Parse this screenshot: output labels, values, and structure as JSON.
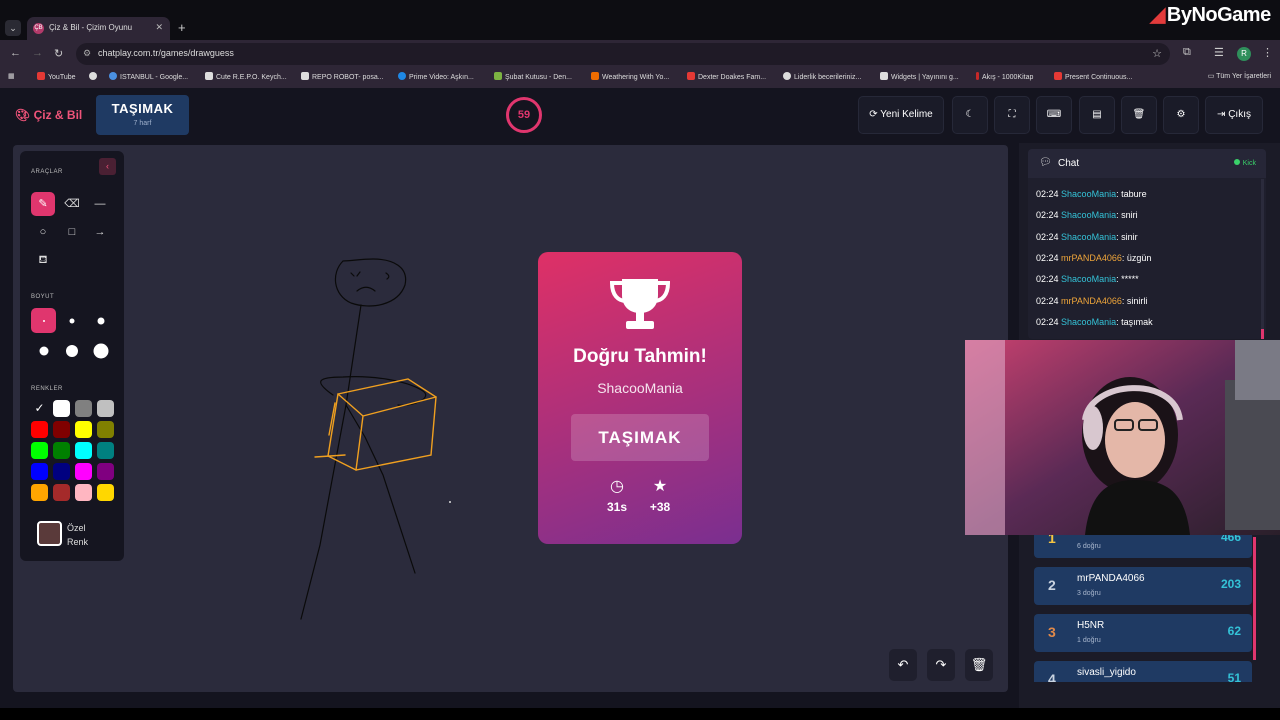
{
  "browser": {
    "tab_title": "Çiz & Bil - Çizim Oyunu",
    "tab_favicon": "ÇB",
    "url": "chatplay.com.tr/games/drawguess",
    "profile_initial": "R",
    "watermark": "ByNoGame",
    "bookmarks": [
      {
        "label": "YouTube",
        "color": "#e53935"
      },
      {
        "label": "",
        "color": "#dddddd"
      },
      {
        "label": "ISTANBUL - Google...",
        "color": "#4a90e2"
      },
      {
        "label": "Cute R.E.P.O. Keych...",
        "color": "#dddddd"
      },
      {
        "label": "REPO ROBOT- posa...",
        "color": "#dddddd"
      },
      {
        "label": "Prime Video: Aşkın...",
        "color": "#1e88e5"
      },
      {
        "label": "Şubat Kutusu - Den...",
        "color": "#7cb342"
      },
      {
        "label": "Weathering With Yo...",
        "color": "#ef6c00"
      },
      {
        "label": "Dexter Doakes Fam...",
        "color": "#e53935"
      },
      {
        "label": "Liderlik becerileriniz...",
        "color": "#dddddd"
      },
      {
        "label": "Widgets | Yayınını g...",
        "color": "#dddddd"
      },
      {
        "label": "Akış - 1000Kitap",
        "color": "#c62828"
      },
      {
        "label": "Present Continuous...",
        "color": "#e53935"
      }
    ],
    "all_bookmarks": "Tüm Yer İşaretleri"
  },
  "header": {
    "logo": "Çiz & Bil",
    "word": "TAŞIMAK",
    "word_hint": "7 harf",
    "timer": "59",
    "new_word": "Yeni Kelime",
    "exit": "Çıkış"
  },
  "tools": {
    "tools_heading": "ARAÇLAR",
    "size_heading": "BOYUT",
    "colors_heading": "RENKLER",
    "custom_color": "Özel Renk",
    "palette": [
      "#000000",
      "#ffffff",
      "#808080",
      "#c0c0c0",
      "#ff0000",
      "#800000",
      "#ffff00",
      "#808000",
      "#00ff00",
      "#008000",
      "#00ffff",
      "#008080",
      "#0000ff",
      "#000080",
      "#ff00ff",
      "#800080",
      "#ffa500",
      "#a52a2a",
      "#ffb6c1",
      "#ffd700"
    ],
    "custom_value": "#5a3a3a"
  },
  "result": {
    "title": "Doğru Tahmin!",
    "user": "ShacooMania",
    "word": "TAŞIMAK",
    "time": "31s",
    "points": "+38"
  },
  "chat": {
    "title": "Chat",
    "platform": "Kick",
    "messages": [
      {
        "time": "02:24",
        "user": "ShacooMania",
        "text": ": tabure",
        "color": "u1"
      },
      {
        "time": "02:24",
        "user": "ShacooMania",
        "text": ": sniri",
        "color": "u1"
      },
      {
        "time": "02:24",
        "user": "ShacooMania",
        "text": ": sinir",
        "color": "u1"
      },
      {
        "time": "02:24",
        "user": "mrPANDA4066",
        "text": ": üzgün",
        "color": "u2"
      },
      {
        "time": "02:24",
        "user": "ShacooMania",
        "text": ": *****",
        "color": "u1"
      },
      {
        "time": "02:24",
        "user": "mrPANDA4066",
        "text": ": sinirli",
        "color": "u2"
      },
      {
        "time": "02:24",
        "user": "ShacooMania",
        "text": ": taşımak",
        "color": "u1"
      }
    ]
  },
  "leaderboard": [
    {
      "rank": "1",
      "name": "ShacooMania",
      "sub": "6 doğru",
      "score": "466",
      "rank_color": "#f5c542"
    },
    {
      "rank": "2",
      "name": "mrPANDA4066",
      "sub": "3 doğru",
      "score": "203",
      "rank_color": "#c9d3e0"
    },
    {
      "rank": "3",
      "name": "H5NR",
      "sub": "1 doğru",
      "score": "62",
      "rank_color": "#e0894a"
    },
    {
      "rank": "4",
      "name": "sivasli_yigido",
      "sub": "",
      "score": "51",
      "rank_color": "#c9d3e0"
    }
  ]
}
